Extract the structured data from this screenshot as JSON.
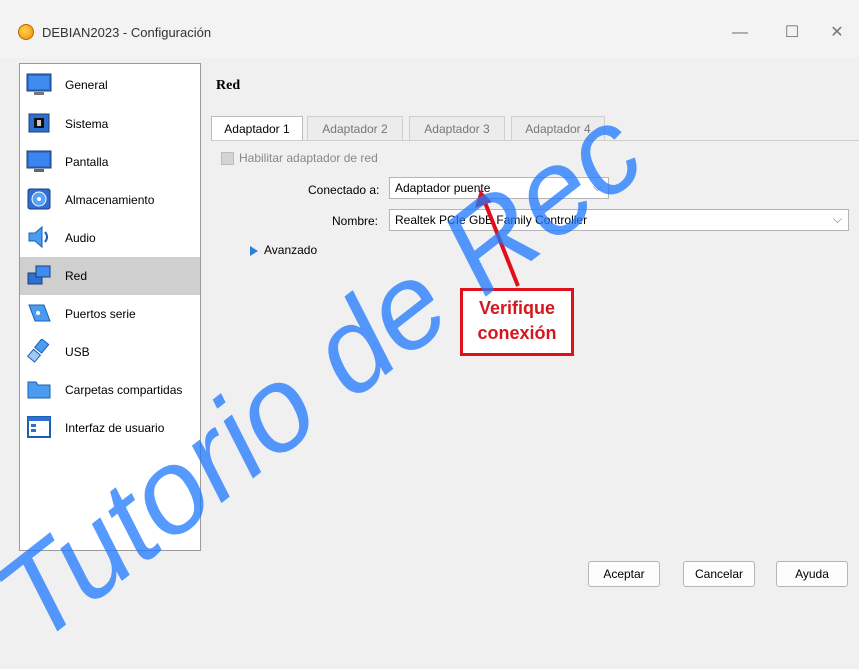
{
  "window": {
    "title": "DEBIAN2023 - Configuración",
    "controls": {
      "minimize": "—",
      "maximize": "☐",
      "close": "✕"
    }
  },
  "sidebar": {
    "items": [
      {
        "label": "General",
        "icon": "general-icon"
      },
      {
        "label": "Sistema",
        "icon": "system-chip-icon"
      },
      {
        "label": "Pantalla",
        "icon": "display-icon"
      },
      {
        "label": "Almacenamiento",
        "icon": "storage-disk-icon"
      },
      {
        "label": "Audio",
        "icon": "speaker-icon"
      },
      {
        "label": "Red",
        "icon": "network-icon",
        "selected": true
      },
      {
        "label": "Puertos serie",
        "icon": "serial-port-icon"
      },
      {
        "label": "USB",
        "icon": "usb-icon"
      },
      {
        "label": "Carpetas compartidas",
        "icon": "folder-icon"
      },
      {
        "label": "Interfaz de usuario",
        "icon": "user-interface-icon"
      }
    ]
  },
  "panel": {
    "title": "Red",
    "tabs": [
      {
        "label": "Adaptador 1",
        "active": true
      },
      {
        "label": "Adaptador 2"
      },
      {
        "label": "Adaptador 3"
      },
      {
        "label": "Adaptador 4"
      }
    ],
    "enable_label": "Habilitar adaptador de red",
    "attached_label": "Conectado a:",
    "attached_value": "Adaptador puente",
    "name_label": "Nombre:",
    "name_value": "Realtek PCIe GbE Family Controller",
    "advanced_label": "Avanzado"
  },
  "annotation": {
    "line1": "Verifique",
    "line2": "conexión",
    "color": "#e0101a"
  },
  "buttons": {
    "ok": "Aceptar",
    "cancel": "Cancelar",
    "help": "Ayuda"
  },
  "watermark": "Tutorio de Rec",
  "colors": {
    "accent": "#2b7fd9",
    "selection": "#cfcfcf",
    "annotation": "#e0101a"
  }
}
